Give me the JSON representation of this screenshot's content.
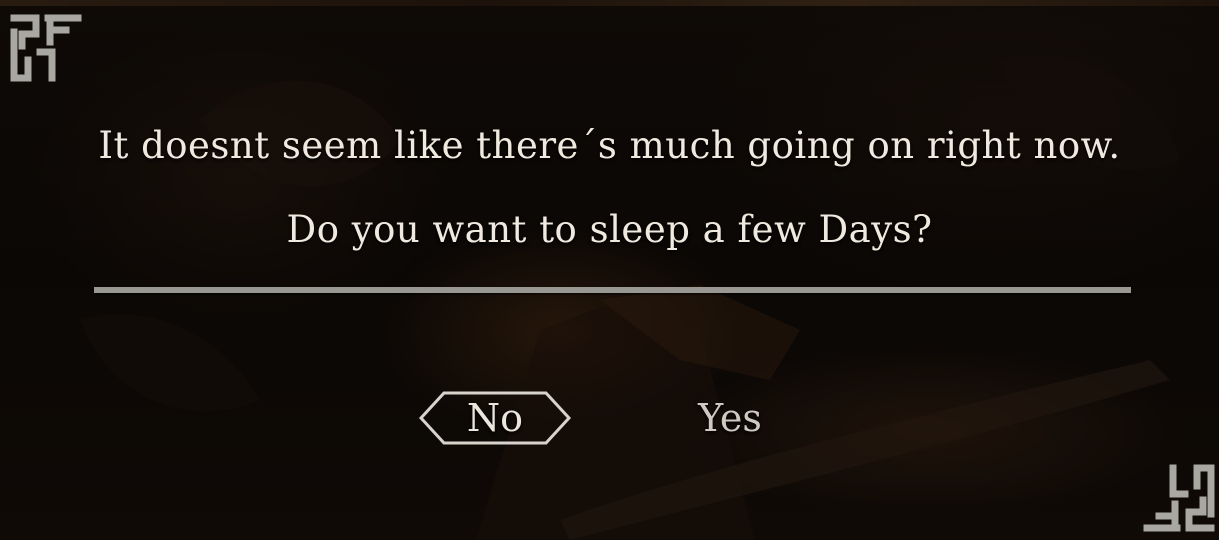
{
  "dialog": {
    "message_line1": "It doesnt seem like there´s much going on right now.",
    "message_line2": "Do you want to sleep a few Days?",
    "no_label": "No",
    "yes_label": "Yes",
    "selected_option": "No"
  },
  "decor": {
    "corner_icon": "knotwork-ornament-icon",
    "divider_color": "#9a9893",
    "text_color": "#efe9df"
  }
}
